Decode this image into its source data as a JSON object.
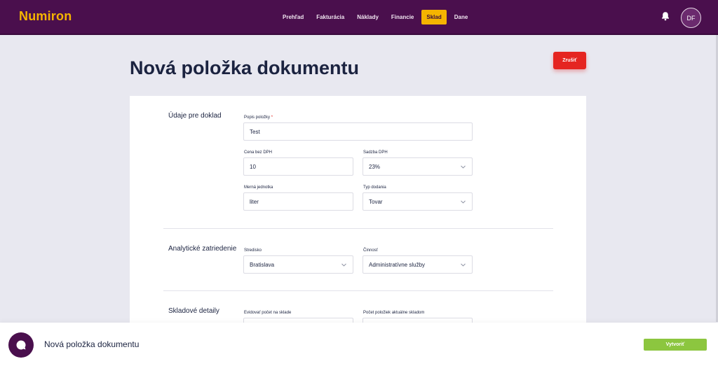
{
  "app": {
    "logo": "Numiron"
  },
  "nav": {
    "items": [
      {
        "label": "Prehľad"
      },
      {
        "label": "Fakturácia"
      },
      {
        "label": "Náklady"
      },
      {
        "label": "Financie"
      },
      {
        "label": "Sklad",
        "active": true
      },
      {
        "label": "Dane"
      }
    ]
  },
  "header": {
    "notification_icon": "bell-icon",
    "avatar_initials": "DF"
  },
  "page": {
    "title": "Nová položka dokumentu",
    "cancel_label": "Zrušiť"
  },
  "sections": {
    "doklad": {
      "title": "Údaje pre doklad",
      "popis": {
        "label": "Popis položky",
        "required_mark": "*",
        "value": "Test"
      },
      "cena": {
        "label": "Cena bez DPH",
        "value": "10"
      },
      "sadzba": {
        "label": "Sadzba DPH",
        "value": "23%"
      },
      "jednotka": {
        "label": "Merná jednotka",
        "value": "liter"
      },
      "typ": {
        "label": "Typ dodania",
        "value": "Tovar"
      }
    },
    "analyticke": {
      "title": "Analytické zatriedenie",
      "stredisko": {
        "label": "Stredisko",
        "value": "Bratislava"
      },
      "cinnost": {
        "label": "Činnosť",
        "value": "Administratívne služby"
      }
    },
    "skladove": {
      "title": "Skladové detaily",
      "evidovat": {
        "label": "Evidovať počet na sklade"
      },
      "pocet": {
        "label": "Počet položiek aktuálne skladom"
      }
    }
  },
  "bottom": {
    "title": "Nová položka dokumentu",
    "create_label": "Vytvoriť",
    "chat_icon": "chat-icon"
  },
  "colors": {
    "brand": "#4a0f4d",
    "accent": "#f5b400",
    "danger": "#e52521",
    "success": "#8cc63f"
  }
}
